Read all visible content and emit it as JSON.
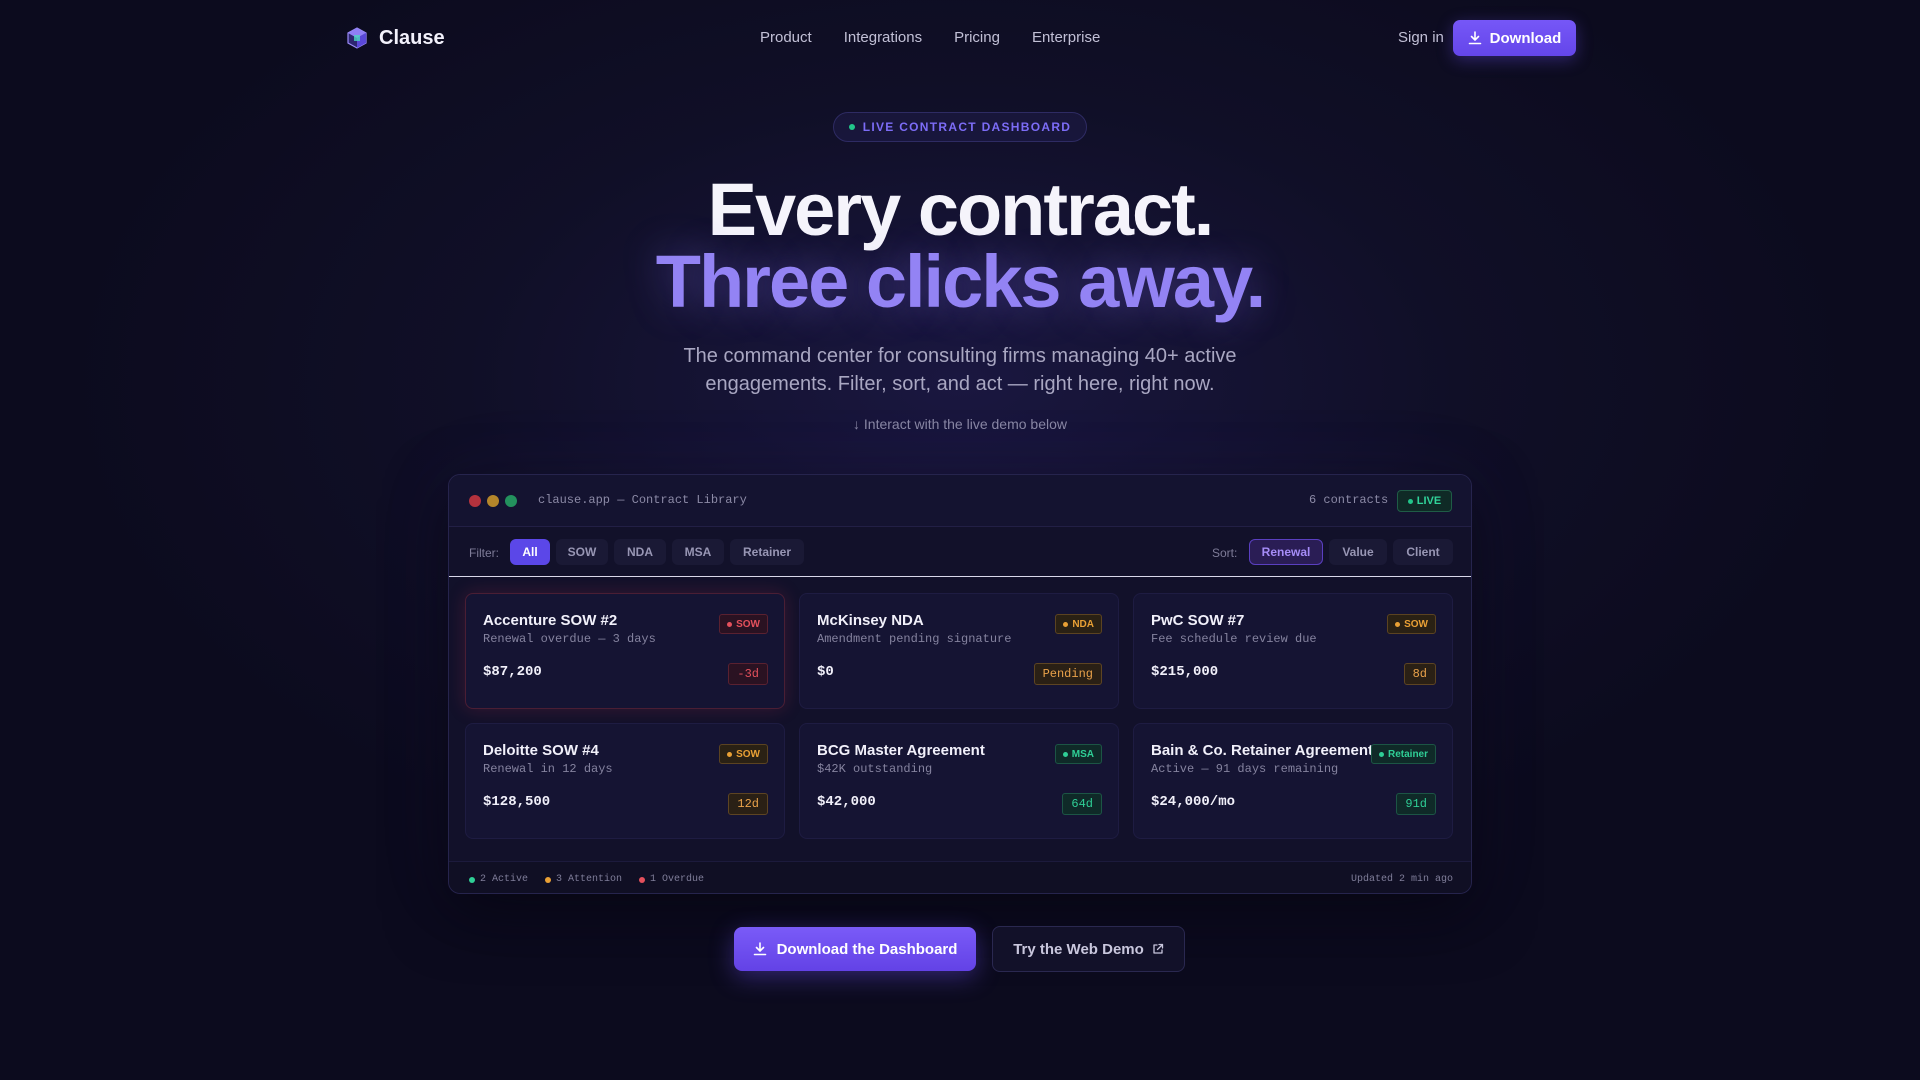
{
  "nav": {
    "brand": "Clause",
    "links": [
      "Product",
      "Integrations",
      "Pricing",
      "Enterprise"
    ],
    "signin": "Sign in",
    "download": "Download"
  },
  "hero": {
    "pill": "LIVE CONTRACT DASHBOARD",
    "title_line1": "Every contract.",
    "title_line2": "Three clicks away.",
    "subtitle": "The command center for consulting firms managing 40+ active engagements. Filter, sort, and act — right here, right now.",
    "hint": "↓ Interact with the live demo below"
  },
  "dashboard": {
    "window_title": "clause.app — Contract Library",
    "count": "6 contracts",
    "live": "LIVE",
    "filter_label": "Filter:",
    "filters": [
      "All",
      "SOW",
      "NDA",
      "MSA",
      "Retainer"
    ],
    "filter_selected": "All",
    "sort_label": "Sort:",
    "sorts": [
      "Renewal",
      "Value",
      "Client"
    ],
    "sort_selected": "Renewal",
    "cards": [
      {
        "name": "Accenture SOW #2",
        "sub": "Renewal overdue — 3 days",
        "value": "$87,200",
        "tag": "SOW",
        "badge": "-3d"
      },
      {
        "name": "McKinsey NDA",
        "sub": "Amendment pending signature",
        "value": "$0",
        "tag": "NDA",
        "badge": "Pending"
      },
      {
        "name": "PwC SOW #7",
        "sub": "Fee schedule review due",
        "value": "$215,000",
        "tag": "SOW",
        "badge": "8d"
      },
      {
        "name": "Deloitte SOW #4",
        "sub": "Renewal in 12 days",
        "value": "$128,500",
        "tag": "SOW",
        "badge": "12d"
      },
      {
        "name": "BCG Master Agreement",
        "sub": "$42K outstanding",
        "value": "$42,000",
        "tag": "MSA",
        "badge": "64d"
      },
      {
        "name": "Bain & Co. Retainer Agreement",
        "sub": "Active — 91 days remaining",
        "value": "$24,000/mo",
        "tag": "Retainer",
        "badge": "91d"
      }
    ],
    "legend": [
      "2 Active",
      "3 Attention",
      "1 Overdue"
    ],
    "updated": "Updated 2 min ago",
    "colors": {
      "overdue": "#e4505c",
      "attention": "#e9a035",
      "active": "#2fcf96",
      "accent": "#6446ea"
    }
  },
  "cta": {
    "primary": "Download the Dashboard",
    "secondary": "Try the Web Demo"
  }
}
